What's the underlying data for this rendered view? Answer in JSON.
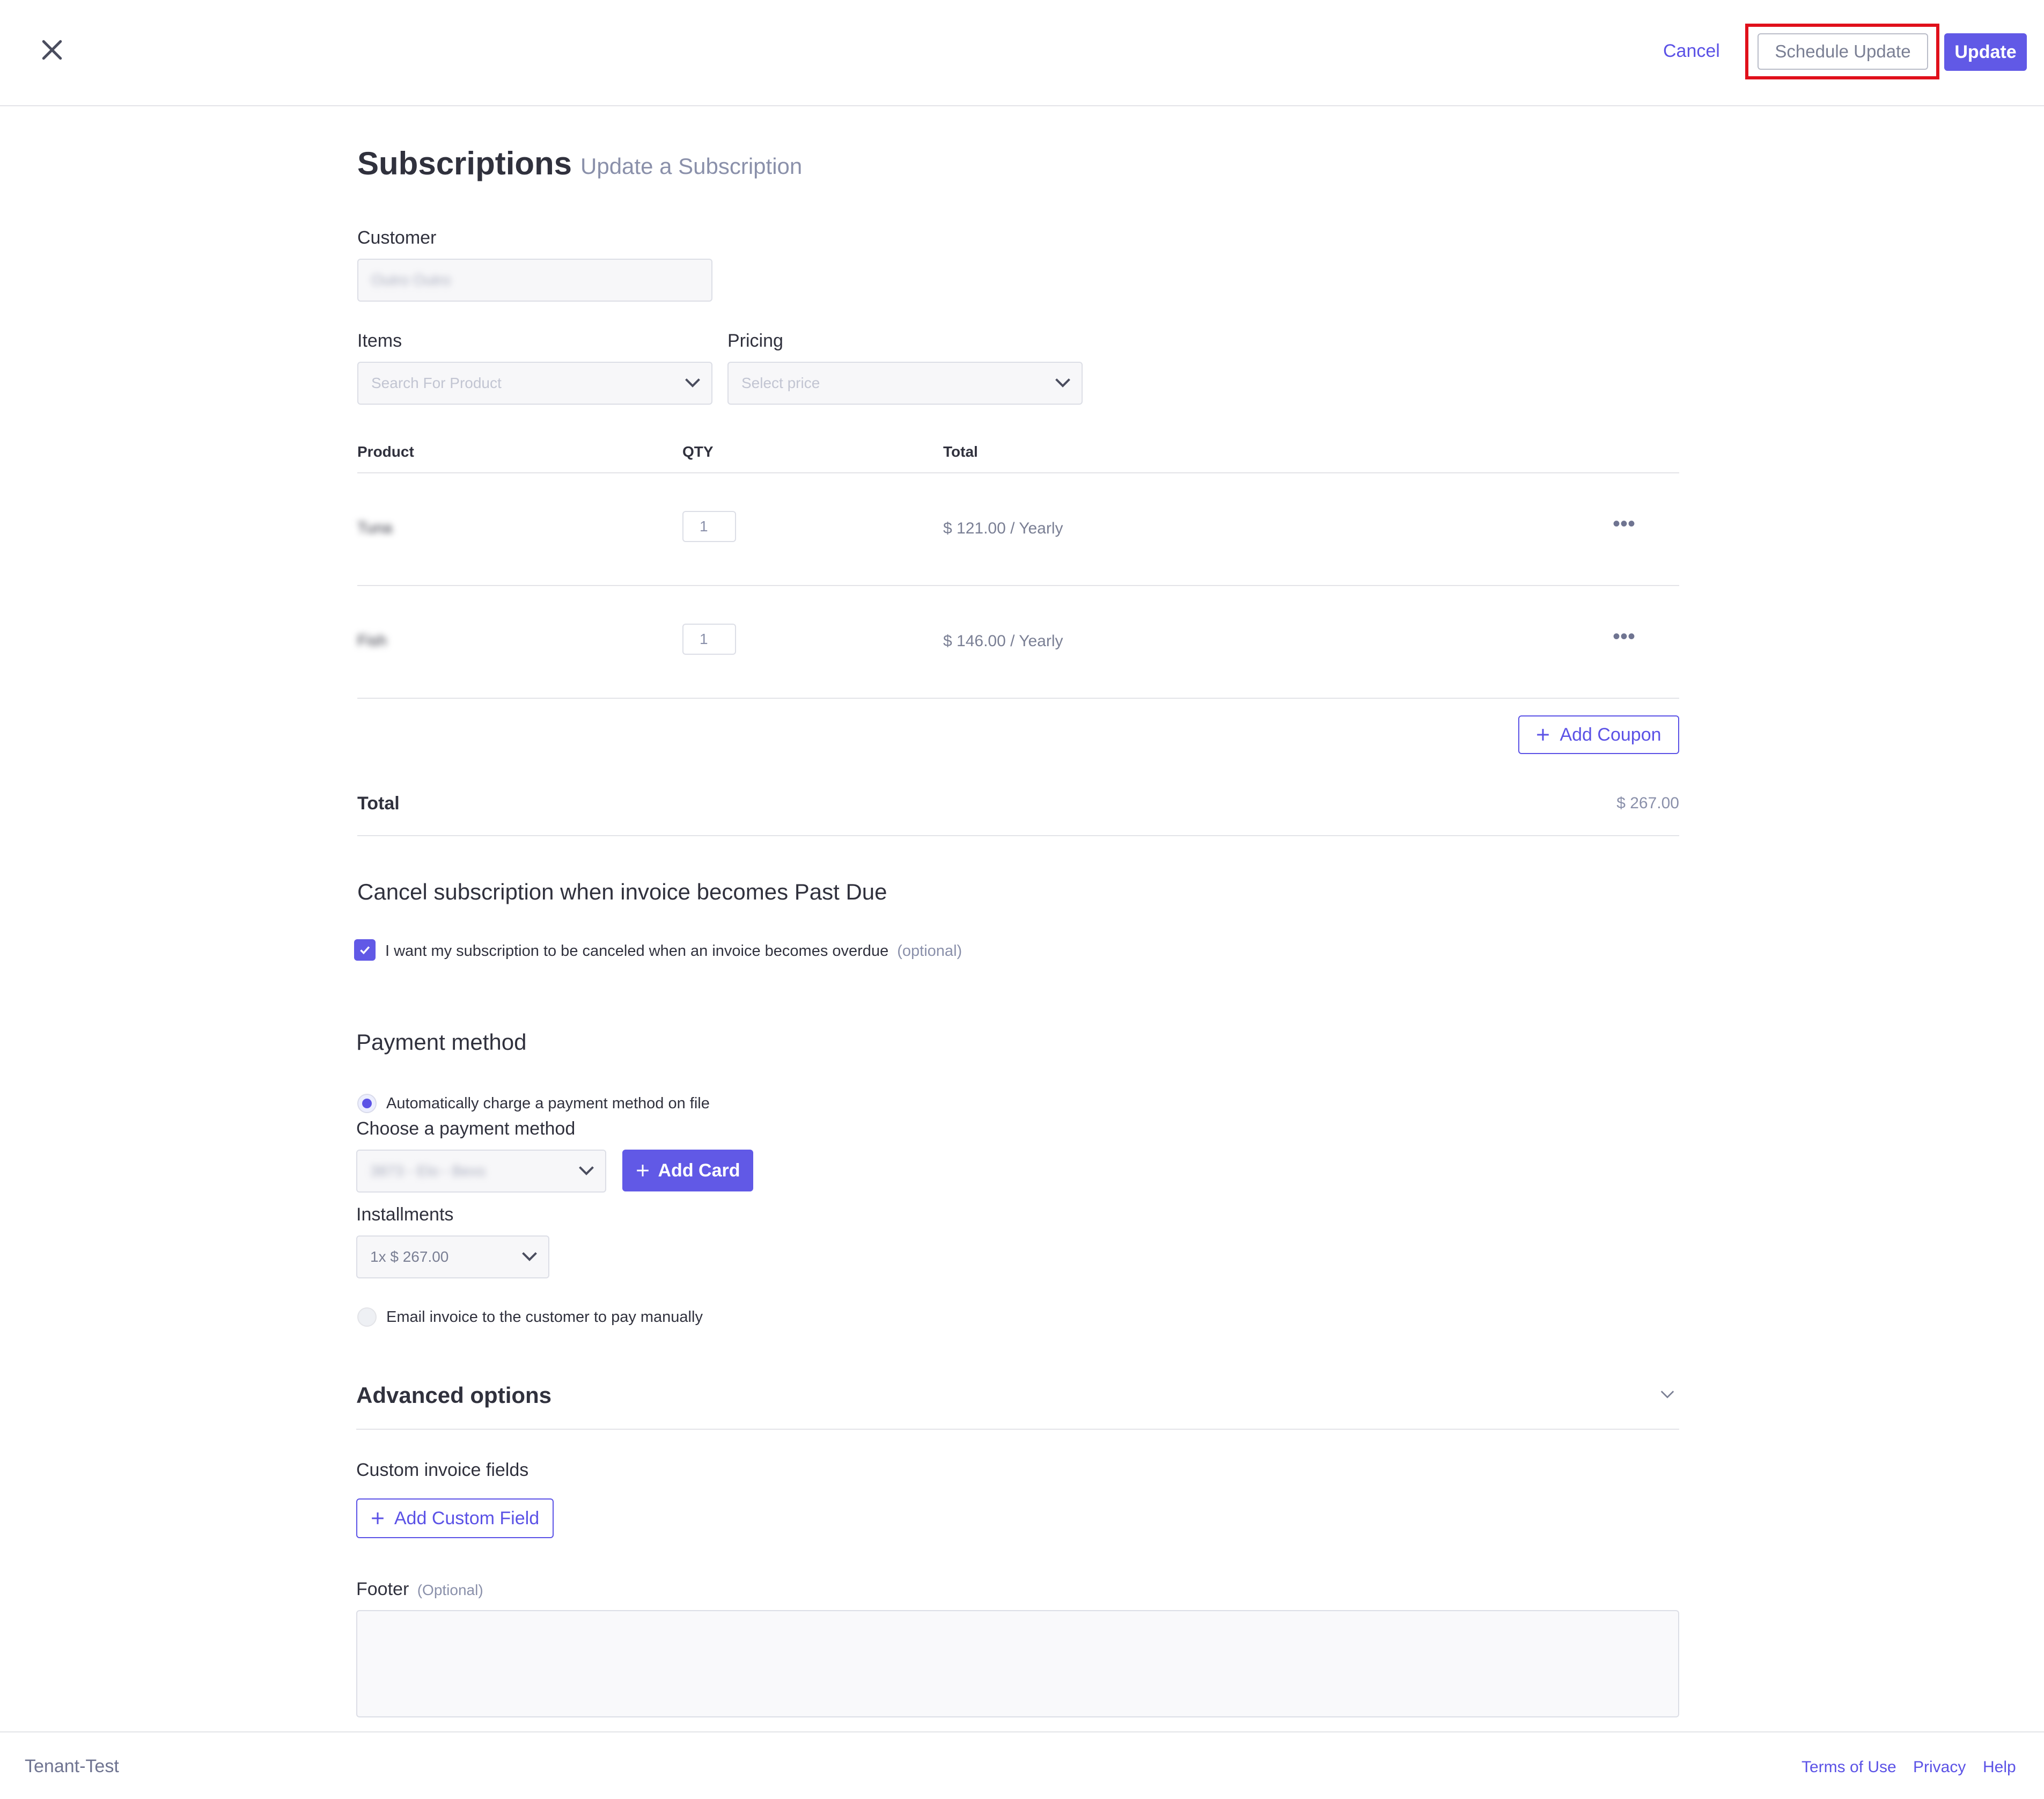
{
  "header": {
    "close_icon": "close-icon",
    "cancel_label": "Cancel",
    "schedule_update_label": "Schedule Update",
    "update_label": "Update",
    "highlight_color": "#e0101b",
    "accent_color": "#6159e6"
  },
  "page": {
    "title": "Subscriptions",
    "subtitle": "Update a Subscription"
  },
  "customer": {
    "label": "Customer",
    "value": "Outro Outro"
  },
  "items": {
    "label": "Items",
    "placeholder": "Search For Product"
  },
  "pricing": {
    "label": "Pricing",
    "placeholder": "Select price"
  },
  "table": {
    "headers": [
      "Product",
      "QTY",
      "Total"
    ],
    "rows": [
      {
        "product": "Tuna",
        "qty": "1",
        "total": "$ 121.00 / Yearly"
      },
      {
        "product": "Fish",
        "qty": "1",
        "total": "$ 146.00 / Yearly"
      }
    ],
    "more_icon": "more-horizontal-icon"
  },
  "coupon": {
    "label": "Add Coupon"
  },
  "summary": {
    "total_label": "Total",
    "total_value": "$ 267.00"
  },
  "past_due": {
    "heading": "Cancel subscription when invoice becomes Past Due",
    "checkbox_label": "I want my subscription to be canceled when an invoice becomes overdue",
    "optional": "(optional)",
    "checked": true
  },
  "payment": {
    "heading": "Payment method",
    "auto_charge_label": "Automatically charge a payment method on file",
    "choose_label": "Choose a payment method",
    "method_value": "3873 - Elo - Bexs",
    "add_card_label": "Add Card",
    "installments_label": "Installments",
    "installments_value": "1x $ 267.00",
    "email_invoice_label": "Email invoice to the customer to pay manually"
  },
  "advanced": {
    "heading": "Advanced options",
    "custom_fields_label": "Custom invoice fields",
    "add_custom_field_label": "Add Custom Field",
    "footer_label": "Footer",
    "footer_optional": "(Optional)"
  },
  "footer": {
    "brand": "Tenant-Test",
    "links": [
      "Terms of Use",
      "Privacy",
      "Help"
    ]
  }
}
